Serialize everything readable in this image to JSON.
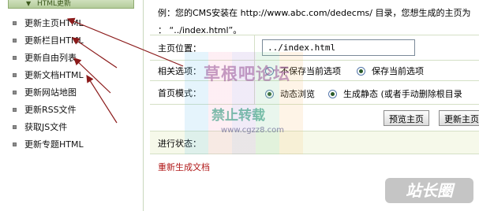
{
  "sidebar": {
    "header": "HTML更新",
    "items": [
      {
        "label": "更新主页HTML"
      },
      {
        "label": "更新栏目HTML"
      },
      {
        "label": "更新自由列表"
      },
      {
        "label": "更新文档HTML"
      },
      {
        "label": "更新网站地图"
      },
      {
        "label": "更新RSS文件"
      },
      {
        "label": "获取JS文件"
      },
      {
        "label": "更新专题HTML"
      }
    ]
  },
  "main": {
    "example_line1": "例：您的CMS安装在 http://www.abc.com/dedecms/ 目录，您想生成的主页为",
    "example_line2": "： “../index.html”。",
    "home_position": {
      "label": "主页位置：",
      "value": "../index.html"
    },
    "related_options": {
      "label": "相关选项：",
      "options": [
        {
          "label": "不保存当前选项",
          "checked": false
        },
        {
          "label": "保存当前选项",
          "checked": true
        }
      ]
    },
    "home_mode": {
      "label": "首页模式：",
      "options": [
        {
          "label": "动态浏览",
          "checked": true
        },
        {
          "label": "生成静态 (或者手动删除根目录",
          "checked": true
        }
      ]
    },
    "buttons": {
      "preview": "预览主页",
      "update": "更新主页"
    },
    "progress_label": "进行状态：",
    "regen_link": "重新生成文档"
  },
  "watermarks": {
    "title": "草根吧论坛",
    "subtitle": "禁止转载",
    "url": "www.cgzz8.com",
    "corner": "站长圈"
  },
  "colors": {
    "arrow": "#8b1a1a",
    "link": "#b01818",
    "sidebar_header": "#b4cc9b",
    "progress_bg": "#f6f9ea"
  }
}
